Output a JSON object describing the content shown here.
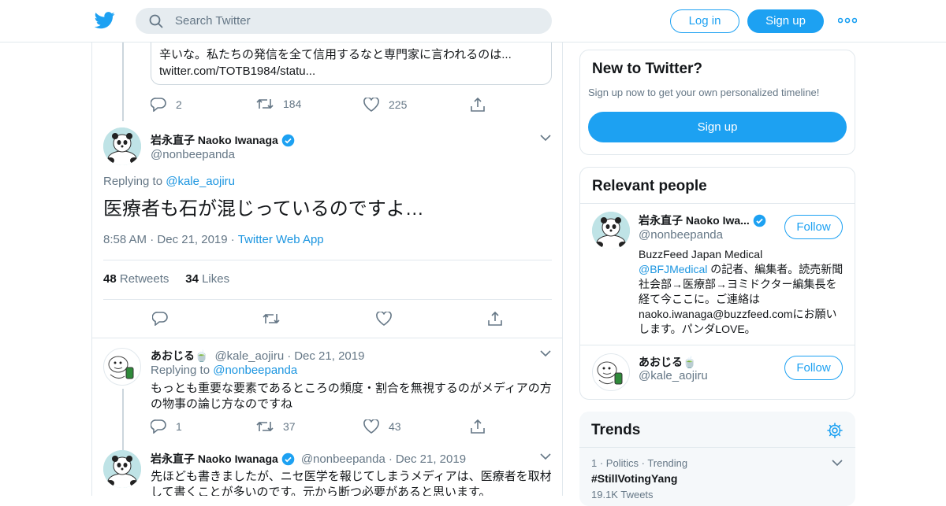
{
  "header": {
    "search_placeholder": "Search Twitter",
    "login_label": "Log in",
    "signup_label": "Sign up"
  },
  "quoted_tweet": {
    "text_line1": "辛いな。私たちの発信を全て信用するなと専門家に言われるのは...",
    "text_line2": "twitter.com/TOTB1984/statu..."
  },
  "parent_tweet_actions": {
    "replies": "2",
    "retweets": "184",
    "likes": "225"
  },
  "main_tweet": {
    "display_name": "岩永直子 Naoko Iwanaga",
    "handle": "@nonbeepanda",
    "replying_prefix": "Replying to",
    "replying_to": "@kale_aojiru",
    "text": "医療者も石が混じっているのですよ…",
    "time": "8:58 AM",
    "date": "Dec 21, 2019",
    "source": "Twitter Web App",
    "retweets_count": "48",
    "retweets_label": "Retweets",
    "likes_count": "34",
    "likes_label": "Likes"
  },
  "reply1": {
    "display_name": "あおじる🍵",
    "handle": "@kale_aojiru",
    "date": "Dec 21, 2019",
    "replying_prefix": "Replying to",
    "replying_to": "@nonbeepanda",
    "text": "もっとも重要な要素であるところの頻度・割合を無視するのがメディアの方の物事の論じ方なのですね",
    "replies": "1",
    "retweets": "37",
    "likes": "43"
  },
  "reply2": {
    "display_name": "岩永直子 Naoko Iwanaga",
    "handle": "@nonbeepanda",
    "date": "Dec 21, 2019",
    "text": "先ほども書きましたが、ニセ医学を報じてしまうメディアは、医療者を取材して書くことが多いのです。元から断つ必要があると思います。"
  },
  "new_to_twitter": {
    "title": "New to Twitter?",
    "subtitle": "Sign up now to get your own personalized timeline!",
    "button": "Sign up"
  },
  "relevant_people": {
    "title": "Relevant people",
    "people": [
      {
        "display_name": "岩永直子 Naoko Iwa...",
        "handle": "@nonbeepanda",
        "follow": "Follow",
        "bio_prefix": "BuzzFeed Japan Medical",
        "bio_link": "@BFJMedical",
        "bio_rest": " の記者、編集者。読売新聞社会部→医療部→ヨミドクター編集長を経て今ここに。ご連絡はnaoko.iwanaga@buzzfeed.comにお願いします。パンダLOVE。"
      },
      {
        "display_name": "あおじる🍵",
        "handle": "@kale_aojiru",
        "follow": "Follow"
      }
    ]
  },
  "trends": {
    "title": "Trends",
    "items": [
      {
        "rank": "1",
        "category": "Politics",
        "status": "Trending",
        "name": "#StillVotingYang",
        "count": "19.1K Tweets"
      }
    ]
  },
  "colors": {
    "accent": "#1da1f2",
    "link": "#1b95e0",
    "muted": "#657786",
    "border": "#e1e8ed"
  }
}
